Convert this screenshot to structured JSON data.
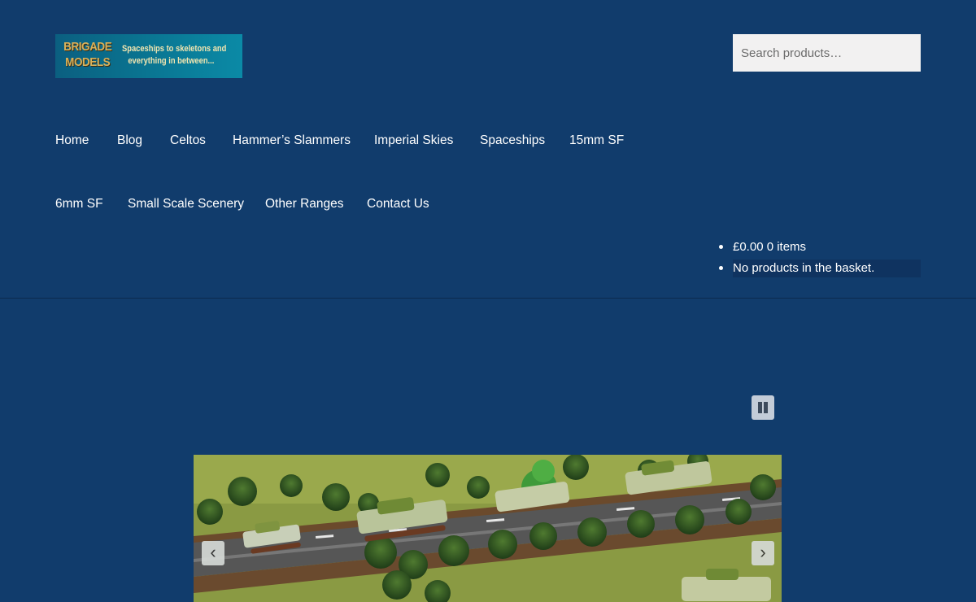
{
  "site": {
    "logo_brand_line1": "BRIGADE",
    "logo_brand_line2": "MODELS",
    "logo_tagline_line1": "Spaceships to skeletons and",
    "logo_tagline_line2": "everything in between..."
  },
  "search": {
    "placeholder": "Search products…"
  },
  "nav": {
    "items": [
      {
        "label": "Home"
      },
      {
        "label": "Blog"
      },
      {
        "label": "Celtos"
      },
      {
        "label": "Hammer’s Slammers"
      },
      {
        "label": "Imperial Skies"
      },
      {
        "label": "Spaceships"
      },
      {
        "label": "15mm SF"
      },
      {
        "label": "6mm SF"
      },
      {
        "label": "Small Scale Scenery"
      },
      {
        "label": "Other Ranges"
      },
      {
        "label": "Contact Us"
      }
    ]
  },
  "cart": {
    "summary": "£0.00 0 items",
    "empty_message": "No products in the basket."
  },
  "slider": {
    "pause_icon": "pause-icon",
    "prev_icon": "chevron-left-icon",
    "next_icon": "chevron-right-icon"
  },
  "colors": {
    "background": "#113c6c",
    "search_bg": "#f2f1f1",
    "text": "#ffffff"
  }
}
